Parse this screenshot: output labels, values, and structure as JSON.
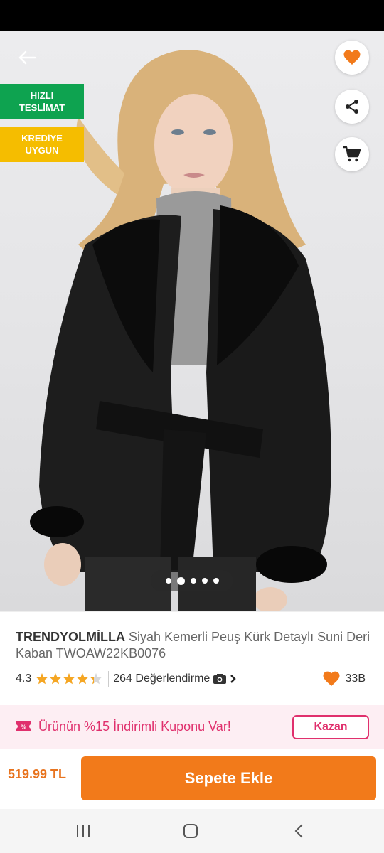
{
  "badges": {
    "fast_delivery": [
      "HIZLI",
      "TESLİMAT"
    ],
    "credit": [
      "KREDİYE",
      "UYGUN"
    ]
  },
  "product": {
    "brand": "TRENDYOLMİLLA",
    "name": "Siyah Kemerli Peuş Kürk Detaylı Suni Deri Kaban TWOAW22KB0076",
    "rating": "4.3",
    "rating_value": 4.3,
    "reviews": "264 Değerlendirme",
    "favorites": "33B"
  },
  "gallery": {
    "image_count": 5,
    "active_index": 1
  },
  "coupon": {
    "text": "Ürünün %15 İndirimli Kuponu Var!",
    "button": "Kazan"
  },
  "purchase": {
    "price": "519.99 TL",
    "add_to_cart": "Sepete Ekle"
  },
  "colors": {
    "primary_orange": "#f27a1a",
    "coupon_pink": "#e0306d",
    "fast_delivery_green": "#0ea350",
    "credit_yellow": "#f5bd00",
    "star_yellow": "#f5a623"
  },
  "icons": {
    "back": "arrow-left-icon",
    "favorite": "heart-icon",
    "share": "share-icon",
    "cart": "cart-icon",
    "camera": "camera-icon",
    "chevron": "chevron-right-icon",
    "coupon": "coupon-icon",
    "nav_recent": "recent-apps-icon",
    "nav_home": "home-icon",
    "nav_back": "nav-back-icon"
  }
}
